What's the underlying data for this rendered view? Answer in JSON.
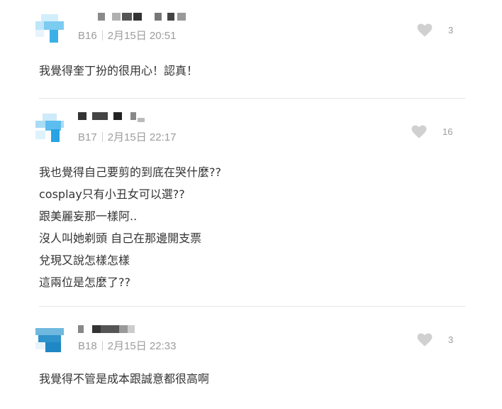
{
  "comments": [
    {
      "floor": "B16",
      "time": "2月15日 20:51",
      "likes": "3",
      "lines": [
        "我覺得奎丁扮的很用心！認真！"
      ]
    },
    {
      "floor": "B17",
      "time": "2月15日 22:17",
      "likes": "16",
      "lines": [
        "我也覺得自己要剪的到底在哭什麼??",
        "cosplay只有小丑女可以選??",
        "跟美麗妄那一樣阿..",
        "沒人叫她剃頭 自己在那邊開支票",
        "兌現又說怎樣怎樣",
        "這兩位是怎麼了??"
      ]
    },
    {
      "floor": "B18",
      "time": "2月15日 22:33",
      "likes": "3",
      "lines": [
        "我覺得不管是成本跟誠意都很高啊"
      ]
    }
  ],
  "icons": {
    "like": "heart-icon"
  },
  "colors": {
    "avatar_accent": "#29a3e3",
    "muted_text": "#9c9c9c",
    "heart": "#d0d0d0"
  }
}
